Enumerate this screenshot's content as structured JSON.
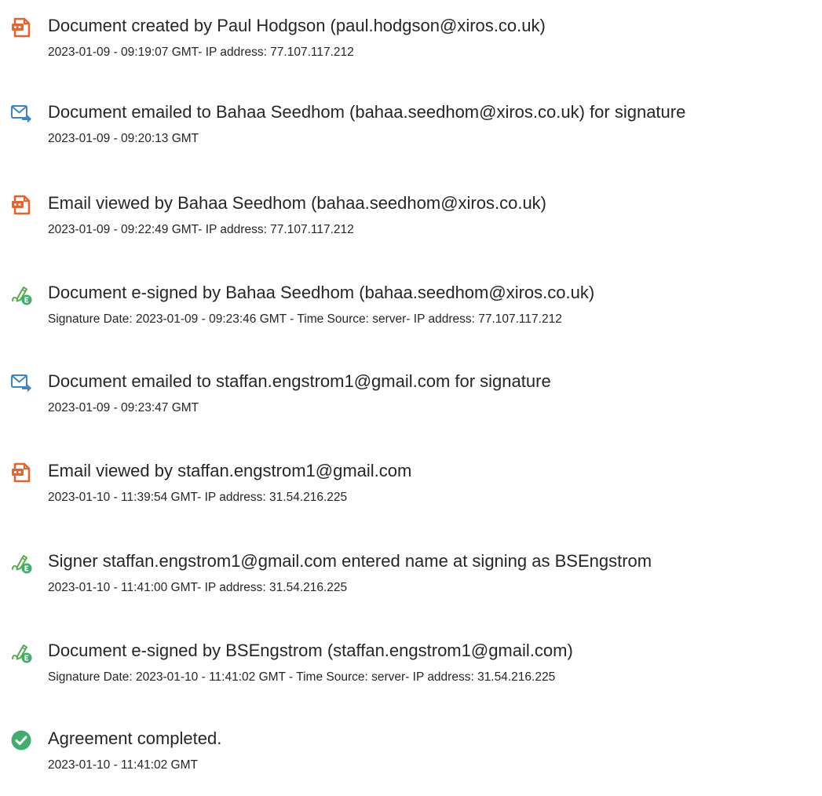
{
  "events": [
    {
      "icon": "document-icon",
      "title": "Document created by Paul Hodgson (paul.hodgson@xiros.co.uk)",
      "detail": "2023-01-09 - 09:19:07 GMT- IP address: 77.107.117.212"
    },
    {
      "icon": "email-sent-icon",
      "title": "Document emailed to Bahaa Seedhom (bahaa.seedhom@xiros.co.uk) for signature",
      "detail": "2023-01-09 - 09:20:13 GMT"
    },
    {
      "icon": "document-icon",
      "title": "Email viewed by Bahaa Seedhom (bahaa.seedhom@xiros.co.uk)",
      "detail": "2023-01-09 - 09:22:49 GMT- IP address: 77.107.117.212"
    },
    {
      "icon": "e-sign-pen-icon",
      "title": "Document e-signed by Bahaa Seedhom (bahaa.seedhom@xiros.co.uk)",
      "detail": "Signature Date: 2023-01-09 - 09:23:46 GMT - Time Source: server- IP address: 77.107.117.212"
    },
    {
      "icon": "email-sent-icon",
      "title": "Document emailed to staffan.engstrom1@gmail.com for signature",
      "detail": "2023-01-09 - 09:23:47 GMT"
    },
    {
      "icon": "document-icon",
      "title": "Email viewed by staffan.engstrom1@gmail.com",
      "detail": "2023-01-10 - 11:39:54 GMT- IP address: 31.54.216.225"
    },
    {
      "icon": "e-sign-pen-icon",
      "title": "Signer staffan.engstrom1@gmail.com entered name at signing as BSEngstrom",
      "detail": "2023-01-10 - 11:41:00 GMT- IP address: 31.54.216.225"
    },
    {
      "icon": "e-sign-pen-icon",
      "title": "Document e-signed by BSEngstrom (staffan.engstrom1@gmail.com)",
      "detail": "Signature Date: 2023-01-10 - 11:41:02 GMT - Time Source: server- IP address: 31.54.216.225"
    },
    {
      "icon": "check-circle-icon",
      "title": "Agreement completed.",
      "detail": "2023-01-10 - 11:41:02 GMT"
    }
  ],
  "colors": {
    "text": "#262626",
    "document_icon": "#e8622d",
    "email_icon": "#3a86c8",
    "sign_icon": "#5aaa4f",
    "complete_icon": "#3fae6c"
  }
}
